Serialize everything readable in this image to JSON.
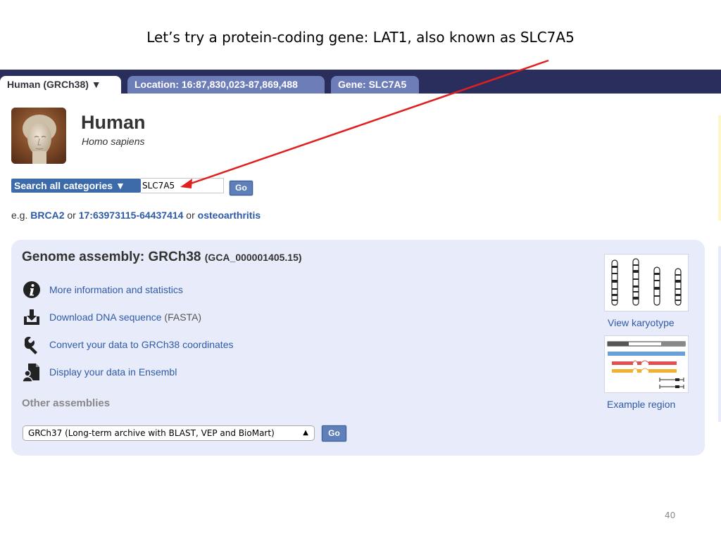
{
  "slide": {
    "title": "Let’s try a protein-coding gene: LAT1, also known as SLC7A5",
    "page_number": "40"
  },
  "tabs": {
    "species": "Human (GRCh38)  ▼",
    "location": "Location: 16:87,830,023-87,869,488",
    "gene": "Gene: SLC7A5"
  },
  "species": {
    "name": "Human",
    "latin": "Homo sapiens"
  },
  "search": {
    "category_label": "Search all categories ▼",
    "value": "SLC7A5",
    "go_label": "Go",
    "eg_prefix": "e.g. ",
    "eg_link1": "BRCA2",
    "eg_or1": " or ",
    "eg_link2": "17:63973115-64437414",
    "eg_or2": " or ",
    "eg_link3": "osteoarthritis"
  },
  "assembly": {
    "heading": "Genome assembly: GRCh38",
    "accession": "(GCA_000001405.15)",
    "links": [
      {
        "icon": "info-icon",
        "label": "More information and statistics",
        "suffix": ""
      },
      {
        "icon": "download-icon",
        "label": "Download DNA sequence",
        "suffix": " (FASTA)"
      },
      {
        "icon": "wrench-icon",
        "label": "Convert your data to GRCh38 coordinates",
        "suffix": ""
      },
      {
        "icon": "user-data-icon",
        "label": "Display your data in Ensembl",
        "suffix": ""
      }
    ],
    "other_label": "Other assemblies",
    "other_select": "GRCh37 (Long-term archive with BLAST, VEP and BioMart)",
    "go_label": "Go",
    "karyotype_label": "View karyotype",
    "region_label": "Example region"
  },
  "colors": {
    "tab_bar": "#2a2e5c",
    "tab_inactive": "#6d7db8",
    "link": "#2e5aa8",
    "panel": "#e8ecfa",
    "arrow": "#e02020"
  }
}
